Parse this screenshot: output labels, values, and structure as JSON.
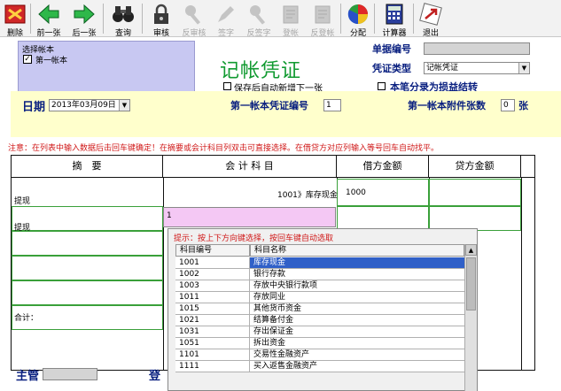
{
  "toolbar": {
    "buttons": [
      {
        "label": "删除",
        "icon": "delete-icon",
        "enabled": true
      },
      {
        "label": "前一张",
        "icon": "arrow-left-icon",
        "enabled": true
      },
      {
        "label": "后一张",
        "icon": "arrow-right-icon",
        "enabled": true
      },
      {
        "label": "查询",
        "icon": "binoculars-icon",
        "enabled": true
      },
      {
        "label": "审核",
        "icon": "lock-icon",
        "enabled": true
      },
      {
        "label": "反审核",
        "icon": "key-icon",
        "enabled": false
      },
      {
        "label": "签字",
        "icon": "pen-icon",
        "enabled": false
      },
      {
        "label": "反签字",
        "icon": "key-icon",
        "enabled": false
      },
      {
        "label": "登帐",
        "icon": "book-icon",
        "enabled": false
      },
      {
        "label": "反登帐",
        "icon": "book-icon",
        "enabled": false
      },
      {
        "label": "分配",
        "icon": "pie-chart-icon",
        "enabled": true
      },
      {
        "label": "计算器",
        "icon": "calculator-icon",
        "enabled": true
      },
      {
        "label": "退出",
        "icon": "exit-icon",
        "enabled": true
      }
    ]
  },
  "account_select": {
    "title": "选择帐本",
    "item_label": "第一帐本",
    "item_checked": true
  },
  "form": {
    "title": "记帐凭证",
    "auto_add_label": "保存后自动新增下一张",
    "doc_no_label": "单据编号",
    "doc_no_value": "",
    "voucher_type_label": "凭证类型",
    "voucher_type_value": "记帐凭证",
    "profit_loss_label": "本笔分录为损益结转",
    "date_label": "日期",
    "date_value": "2013年03月09日",
    "voucher_no_label": "第一帐本凭证编号",
    "voucher_no_value": "1",
    "attach_label": "第一帐本附件张数",
    "attach_value": "0",
    "attach_unit": "张"
  },
  "notice": "注意：在列表中输入数据后击回车键确定！在摘要或会计科目列双击可直接选择。在借贷方对应列输入等号回车自动找平。",
  "table": {
    "headers": [
      "摘　要",
      "会 计 科 目",
      "借方金额",
      "贷方金额"
    ],
    "rows": [
      {
        "summary": "提现",
        "account": "1001》库存现金",
        "debit": "1000",
        "credit": ""
      },
      {
        "summary": "提现",
        "account": "1",
        "debit": "",
        "credit": ""
      }
    ],
    "total_label": "合计："
  },
  "popup": {
    "hint": "提示：按上下方向键选择，按回车键自动选取",
    "col_code": "科目编号",
    "col_name": "科目名称",
    "rows": [
      {
        "code": "1001",
        "name": "库存现金"
      },
      {
        "code": "1002",
        "name": "银行存款"
      },
      {
        "code": "1003",
        "name": "存放中央银行款项"
      },
      {
        "code": "1011",
        "name": "存放同业"
      },
      {
        "code": "1015",
        "name": "其他货币资金"
      },
      {
        "code": "1021",
        "name": "结算备付金"
      },
      {
        "code": "1031",
        "name": "存出保证金"
      },
      {
        "code": "1051",
        "name": "拆出资金"
      },
      {
        "code": "1101",
        "name": "交易性金融资产"
      },
      {
        "code": "1111",
        "name": "买入返售金融资产"
      }
    ]
  },
  "bottom": {
    "supervisor_label": "主管",
    "supervisor_value": "",
    "register_label": "登"
  },
  "colors": {
    "title_green": "#109a30",
    "label_blue": "#0a2080",
    "notice_red": "#d01818",
    "selection_blue": "#3060c8",
    "account_box": "#c8c8f2",
    "date_bar": "#ffffcc",
    "edit_cell": "#f4c8f4"
  }
}
